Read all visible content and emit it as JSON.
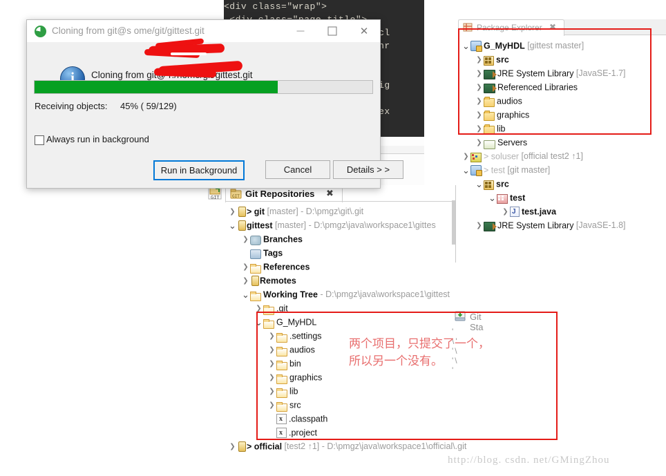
{
  "code_editor": {
    "lines": [
      "<div class=\"wrap\">",
      " <div class=\"page-title\">",
      "                      \"><i cl",
      "                      \"><a hr",
      "",
      "",
      "                      xt-alig",
      "",
      "                      ss=\"tex"
    ]
  },
  "git_staging_tab": {
    "label": "Git Sta",
    "icon": "git-staging-icon",
    "dots": "' \\' '\\ '\\  '"
  },
  "dialog": {
    "title": "Cloning from git@s                  ome/git/gittest.git",
    "icon": "eclipse-icon",
    "minimize": "minimize-icon",
    "maximize": "maximize-icon",
    "close": "close-icon",
    "message": "Cloning from git@            r:/nome/git/gittest.git",
    "info_icon": "info-icon",
    "progress": {
      "percent": 72,
      "fill_color": "#06a022",
      "track_color": "#e6e6e6"
    },
    "status_label": "Receiving objects:",
    "status_value": "45% ( 59/129)",
    "checkbox_label": "Always run in background",
    "checkbox_checked": false,
    "buttons": {
      "run_in_background": "Run in Background",
      "cancel": "Cancel",
      "details": "Details > >"
    },
    "focus_color": "#0078d7"
  },
  "package_explorer": {
    "tab_label": "Package Explorer",
    "tab_icon": "package-explorer-icon",
    "tab_close": "✖",
    "highlight_color": "#e41b17",
    "tree": [
      {
        "indent": 0,
        "arrow": "v",
        "icon": "java-project-icon",
        "label": "G_MyHDL",
        "meta": " [gittest master]",
        "bold": true
      },
      {
        "indent": 1,
        "arrow": ">",
        "icon": "source-folder-icon",
        "label": "src",
        "meta": "",
        "bold": true
      },
      {
        "indent": 1,
        "arrow": ">",
        "icon": "jre-library-icon",
        "label": "JRE System Library",
        "meta": " [JavaSE-1.7]",
        "bold": false
      },
      {
        "indent": 1,
        "arrow": ">",
        "icon": "jre-library-icon",
        "label": "Referenced Libraries",
        "meta": "",
        "bold": false
      },
      {
        "indent": 1,
        "arrow": ">",
        "icon": "folder-icon",
        "label": "audios",
        "meta": "",
        "bold": false
      },
      {
        "indent": 1,
        "arrow": ">",
        "icon": "folder-icon",
        "label": "graphics",
        "meta": "",
        "bold": false
      },
      {
        "indent": 1,
        "arrow": ">",
        "icon": "folder-icon",
        "label": "lib",
        "meta": "",
        "bold": false
      },
      {
        "indent": 1,
        "arrow": ">",
        "icon": "servers-icon",
        "label": "Servers",
        "meta": "",
        "bold": false
      },
      {
        "indent": 0,
        "arrow": ">",
        "icon": "module-icon",
        "label": "> soluser",
        "meta": " [official test2 ↑1]",
        "bold": false,
        "dim": true
      },
      {
        "indent": 0,
        "arrow": "v",
        "icon": "java-project-icon",
        "label": "> test",
        "meta": " [git master]",
        "bold": false,
        "dim": true
      },
      {
        "indent": 1,
        "arrow": "v",
        "icon": "source-folder-icon",
        "label": "src",
        "meta": "",
        "bold": true
      },
      {
        "indent": 2,
        "arrow": "v",
        "icon": "package-icon",
        "label": "test",
        "meta": "",
        "bold": true
      },
      {
        "indent": 3,
        "arrow": ">",
        "icon": "java-file-icon",
        "label": "test.java",
        "meta": "",
        "bold": true
      },
      {
        "indent": 1,
        "arrow": ">",
        "icon": "jre-library-icon",
        "label": "JRE System Library",
        "meta": " [JavaSE-1.8]",
        "bold": false
      }
    ]
  },
  "git_repositories": {
    "tab_label": "Git Repositories",
    "tab_icon": "git-repositories-icon",
    "tab_close": "✖",
    "toolbar_icon": "git-view-icon",
    "tree": [
      {
        "indent": 0,
        "arrow": ">",
        "icon": "repository-icon",
        "label": "> git",
        "meta": " [master]",
        "path": " - D:\\pmgz\\git\\.git",
        "bold": true
      },
      {
        "indent": 0,
        "arrow": "v",
        "icon": "repository-icon",
        "label": "gittest",
        "meta": " [master]",
        "path": " - D:\\pmgz\\java\\workspace1\\gittes",
        "bold": true
      },
      {
        "indent": 1,
        "arrow": ">",
        "icon": "branches-icon",
        "label": "Branches",
        "meta": "",
        "path": "",
        "bold": true
      },
      {
        "indent": 1,
        "arrow": "",
        "icon": "tags-icon",
        "label": "Tags",
        "meta": "",
        "path": "",
        "bold": true
      },
      {
        "indent": 1,
        "arrow": ">",
        "icon": "folder-open-icon",
        "label": "References",
        "meta": "",
        "path": "",
        "bold": true
      },
      {
        "indent": 1,
        "arrow": ">",
        "icon": "repository-icon",
        "label": "Remotes",
        "meta": "",
        "path": "",
        "bold": true
      },
      {
        "indent": 1,
        "arrow": "v",
        "icon": "folder-open-icon",
        "label": "Working Tree",
        "meta": "",
        "path": " - D:\\pmgz\\java\\workspace1\\gittest",
        "bold": true
      },
      {
        "indent": 2,
        "arrow": ">",
        "icon": "folder-open-icon",
        "label": ".git",
        "meta": "",
        "path": "",
        "bold": false
      },
      {
        "indent": 2,
        "arrow": "v",
        "icon": "folder-open-icon",
        "label": "G_MyHDL",
        "meta": "",
        "path": "",
        "bold": false
      },
      {
        "indent": 3,
        "arrow": ">",
        "icon": "folder-open-icon",
        "label": ".settings",
        "meta": "",
        "path": "",
        "bold": false
      },
      {
        "indent": 3,
        "arrow": ">",
        "icon": "folder-open-icon",
        "label": "audios",
        "meta": "",
        "path": "",
        "bold": false
      },
      {
        "indent": 3,
        "arrow": ">",
        "icon": "folder-open-icon",
        "label": "bin",
        "meta": "",
        "path": "",
        "bold": false
      },
      {
        "indent": 3,
        "arrow": ">",
        "icon": "folder-open-icon",
        "label": "graphics",
        "meta": "",
        "path": "",
        "bold": false
      },
      {
        "indent": 3,
        "arrow": ">",
        "icon": "folder-open-icon",
        "label": "lib",
        "meta": "",
        "path": "",
        "bold": false
      },
      {
        "indent": 3,
        "arrow": ">",
        "icon": "folder-open-icon",
        "label": "src",
        "meta": "",
        "path": "",
        "bold": false
      },
      {
        "indent": 3,
        "arrow": "",
        "icon": "xml-file-icon",
        "label": ".classpath",
        "meta": "",
        "path": "",
        "bold": false
      },
      {
        "indent": 3,
        "arrow": "",
        "icon": "xml-file-icon",
        "label": ".project",
        "meta": "",
        "path": "",
        "bold": false
      },
      {
        "indent": 0,
        "arrow": ">",
        "icon": "repository-icon",
        "label": "> official",
        "meta": " [test2 ↑1]",
        "path": " - D:\\pmgz\\java\\workspace1\\official\\.git",
        "bold": true
      }
    ]
  },
  "annotation": {
    "note_text": "两个项目，只提交了一个，\n所以另一个没有。",
    "note_color": "#e86e6e",
    "box_color": "#e41b17"
  },
  "watermark": {
    "text": "http://blog. csdn. net/GMingZhou"
  }
}
